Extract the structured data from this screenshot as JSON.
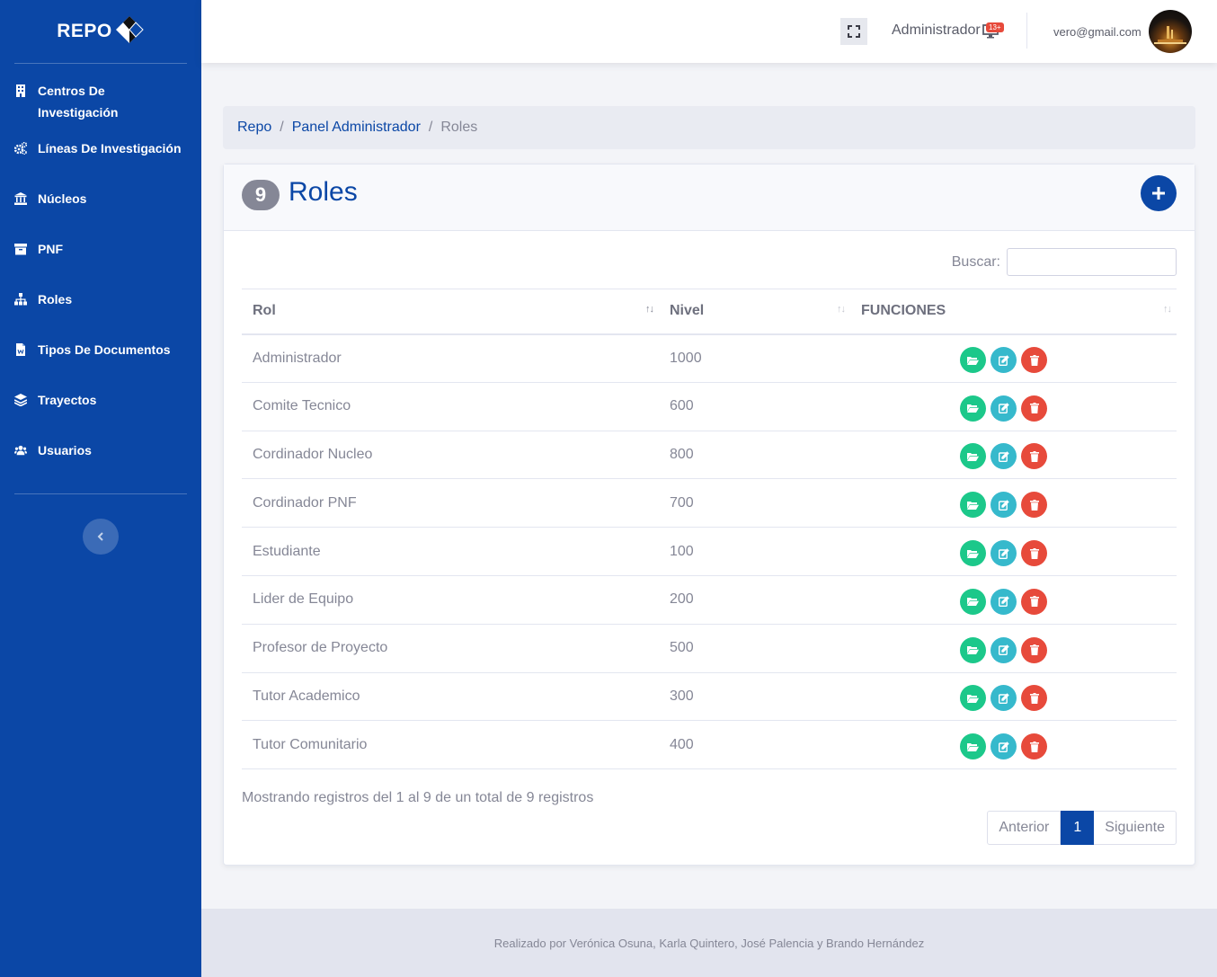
{
  "brand": {
    "name": "REPO"
  },
  "sidebar": {
    "items": [
      {
        "label": "Centros De Investigación",
        "icon": "building-icon"
      },
      {
        "label": "Líneas De Investigación",
        "icon": "cogs-icon"
      },
      {
        "label": "Núcleos",
        "icon": "university-icon"
      },
      {
        "label": "PNF",
        "icon": "archive-icon"
      },
      {
        "label": "Roles",
        "icon": "sitemap-icon"
      },
      {
        "label": "Tipos De Documentos",
        "icon": "file-word-icon"
      },
      {
        "label": "Trayectos",
        "icon": "layer-group-icon"
      },
      {
        "label": "Usuarios",
        "icon": "users-icon"
      }
    ],
    "toggle_icon": "chevron-left-icon"
  },
  "topbar": {
    "role": "Administrador",
    "notification_count": "13+",
    "user_email": "vero@gmail.com"
  },
  "breadcrumb": {
    "items": [
      "Repo",
      "Panel Administrador"
    ],
    "active": "Roles"
  },
  "card": {
    "count": "9",
    "title": "Roles"
  },
  "search": {
    "label": "Buscar:",
    "value": ""
  },
  "table": {
    "headers": [
      "Rol",
      "Nivel",
      "FUNCIONES"
    ],
    "rows": [
      {
        "rol": "Administrador",
        "nivel": "1000"
      },
      {
        "rol": "Comite Tecnico",
        "nivel": "600"
      },
      {
        "rol": "Cordinador Nucleo",
        "nivel": "800"
      },
      {
        "rol": "Cordinador PNF",
        "nivel": "700"
      },
      {
        "rol": "Estudiante",
        "nivel": "100"
      },
      {
        "rol": "Lider de Equipo",
        "nivel": "200"
      },
      {
        "rol": "Profesor de Proyecto",
        "nivel": "500"
      },
      {
        "rol": "Tutor Academico",
        "nivel": "300"
      },
      {
        "rol": "Tutor Comunitario",
        "nivel": "400"
      }
    ]
  },
  "pagination": {
    "info": "Mostrando registros del 1 al 9 de un total de 9 registros",
    "prev": "Anterior",
    "current": "1",
    "next": "Siguiente"
  },
  "footer": {
    "text": "Realizado por Verónica Osuna, Karla Quintero, José Palencia y Brando Hernández"
  },
  "colors": {
    "primary": "#0b47a6",
    "success": "#1cc88a",
    "info": "#36b9cc",
    "danger": "#e74a3b"
  }
}
